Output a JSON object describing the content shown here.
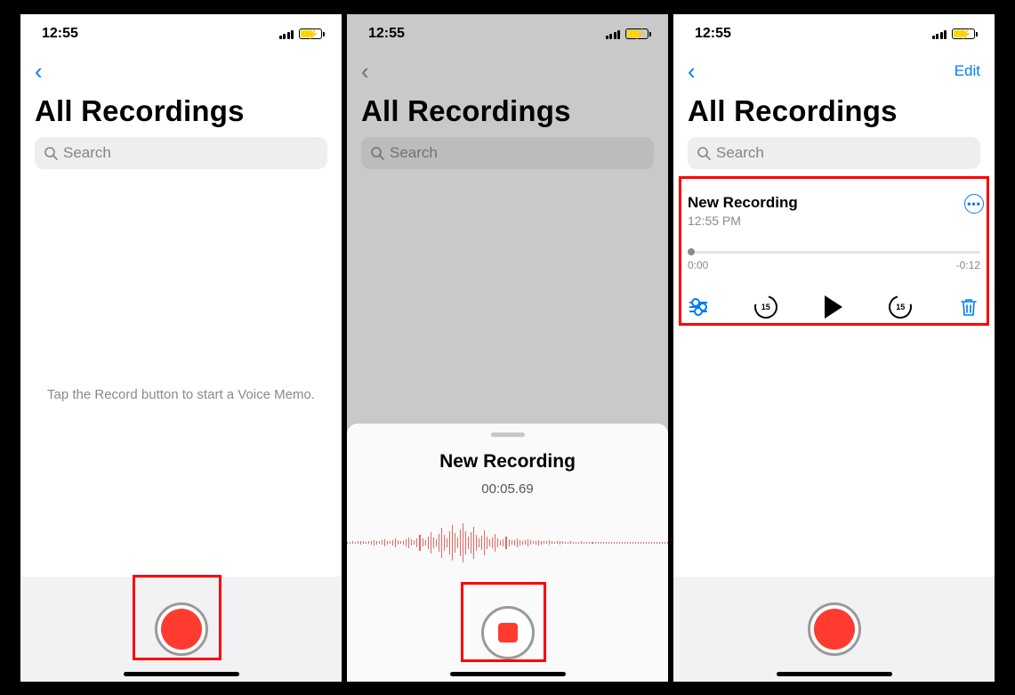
{
  "status": {
    "time": "12:55"
  },
  "screen1": {
    "title": "All Recordings",
    "search_placeholder": "Search",
    "empty_hint": "Tap the Record button to start a Voice Memo."
  },
  "screen2": {
    "title": "All Recordings",
    "search_placeholder": "Search",
    "sheet_title": "New Recording",
    "timer": "00:05.69"
  },
  "screen3": {
    "title": "All Recordings",
    "edit_label": "Edit",
    "search_placeholder": "Search",
    "item": {
      "title": "New Recording",
      "subtitle": "12:55 PM",
      "elapsed": "0:00",
      "remaining": "-0:12",
      "skip_seconds": "15"
    }
  }
}
